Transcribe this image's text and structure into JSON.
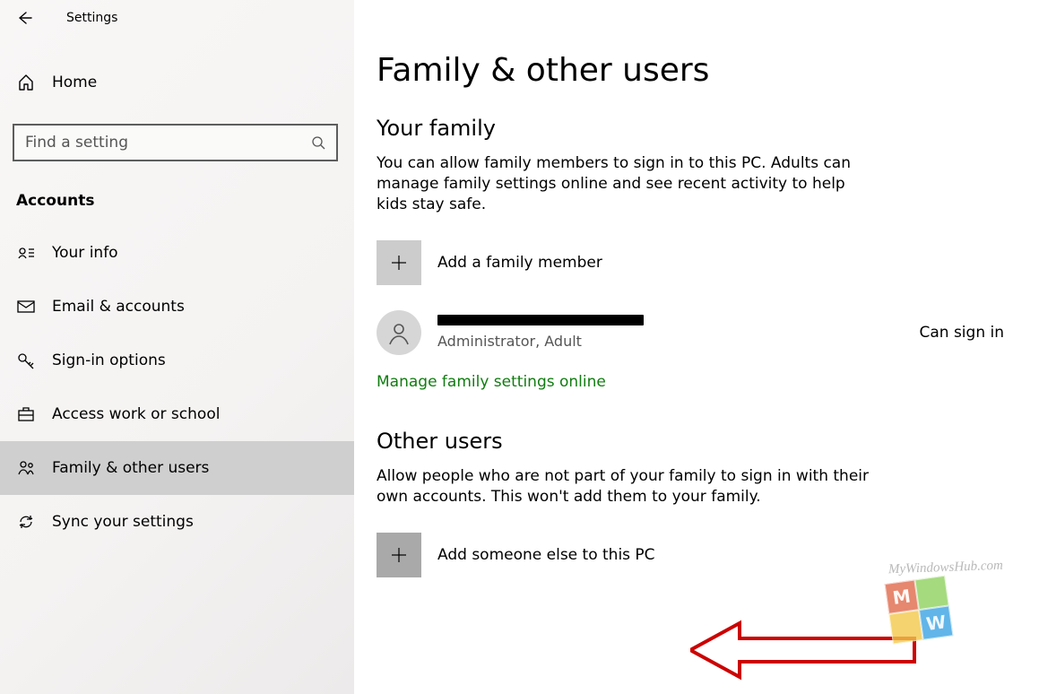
{
  "header": {
    "app_title": "Settings"
  },
  "sidebar": {
    "home_label": "Home",
    "search_placeholder": "Find a setting",
    "section_label": "Accounts",
    "items": [
      {
        "label": "Your info"
      },
      {
        "label": "Email & accounts"
      },
      {
        "label": "Sign-in options"
      },
      {
        "label": "Access work or school"
      },
      {
        "label": "Family & other users"
      },
      {
        "label": "Sync your settings"
      }
    ]
  },
  "main": {
    "page_title": "Family & other users",
    "family": {
      "heading": "Your family",
      "desc": "You can allow family members to sign in to this PC. Adults can manage family settings online and see recent activity to help kids stay safe.",
      "add_label": "Add a family member",
      "member_role": "Administrator, Adult",
      "member_status": "Can sign in",
      "manage_link": "Manage family settings online"
    },
    "other": {
      "heading": "Other users",
      "desc": "Allow people who are not part of your family to sign in with their own accounts. This won't add them to your family.",
      "add_label": "Add someone else to this PC"
    }
  },
  "watermark": {
    "text": "MyWindowsHub.com"
  }
}
